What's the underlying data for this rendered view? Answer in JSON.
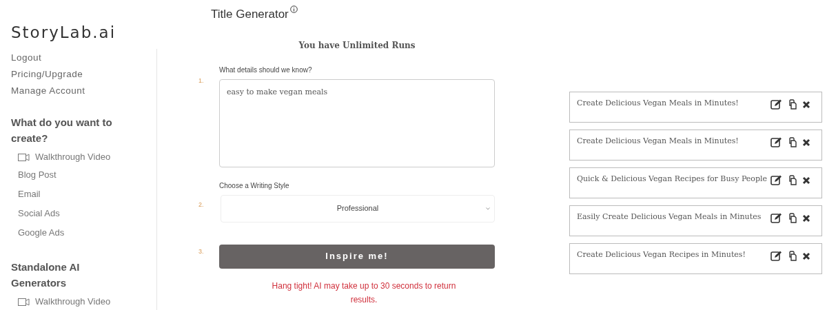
{
  "logo": "StoryLab.ai",
  "sidebar": {
    "account_links": [
      "Logout",
      "Pricing/Upgrade",
      "Manage Account"
    ],
    "sections": [
      {
        "heading": "What do you want to create?",
        "items": [
          {
            "label": "Walkthrough Video",
            "kind": "video"
          },
          {
            "label": "Blog Post",
            "kind": "link"
          },
          {
            "label": "Email",
            "kind": "link"
          },
          {
            "label": "Social Ads",
            "kind": "link"
          },
          {
            "label": "Google Ads",
            "kind": "link"
          }
        ]
      },
      {
        "heading": "Standalone AI Generators",
        "items": [
          {
            "label": "Walkthrough Video",
            "kind": "video"
          }
        ]
      }
    ]
  },
  "page_title": "Title Generator",
  "runs_notice": "You have Unlimited Runs",
  "steps": [
    {
      "number": "1.",
      "kind": "textarea",
      "label": "What details should we know?",
      "value": "easy to make vegan meals"
    },
    {
      "number": "2.",
      "kind": "select",
      "label": "Choose a Writing Style",
      "value": "Professional"
    },
    {
      "number": "3.",
      "kind": "button",
      "value": "Inspire me!"
    }
  ],
  "wait_message": "Hang tight! AI may take up to 30 seconds to return results.",
  "results": [
    "Create Delicious Vegan Meals in Minutes!",
    "Create Delicious Vegan Meals in Minutes!",
    "Quick & Delicious Vegan Recipes for Busy People",
    "Easily Create Delicious Vegan Meals in Minutes",
    "Create Delicious Vegan Recipes in Minutes!"
  ]
}
